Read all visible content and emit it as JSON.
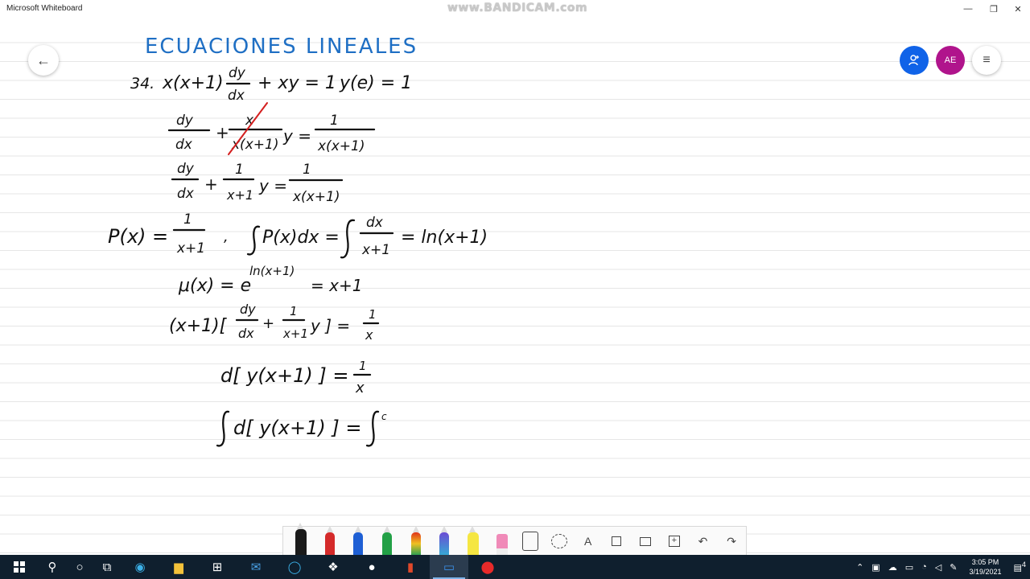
{
  "window": {
    "title": "Microsoft Whiteboard",
    "watermark": "www.BANDICAM.com"
  },
  "header": {
    "share_icon": "person-add-icon",
    "avatar_initials": "AE",
    "menu_icon": "hamburger-icon",
    "back_icon": "arrow-left-icon"
  },
  "board": {
    "title": "ECUACIONES LINEALES",
    "title_color": "#1f6fc4",
    "lines": [
      "34. x(x+1) dy/dx + xy = 1 ,  y(e) = 1",
      "dy/dx + x/(x(x+1)) y = 1/(x(x+1))",
      "dy/dx + 1/(x+1) y = 1/(x(x+1))",
      "P(x) = 1/(x+1) ,  ∫P(x)dx = ∫dx/(x+1) = ln(x+1)",
      "μ(x) = e^ln(x+1) = x+1",
      "(x+1)[ dy/dx + 1/(x+1) y ] = 1/x",
      "d[ y(x+1) ] = 1/x",
      "∫d[ y(x+1) ] = ∫"
    ],
    "strike_color": "#d41f1f"
  },
  "toolbar": {
    "tools": [
      {
        "name": "black-pen",
        "color": "#1a1a1a"
      },
      {
        "name": "red-pen",
        "color": "#d42a2a"
      },
      {
        "name": "blue-pen",
        "color": "#1e5fd4"
      },
      {
        "name": "green-pen",
        "color": "#22a046"
      },
      {
        "name": "rainbow-pen",
        "color": "#e07b1a"
      },
      {
        "name": "galaxy-pen",
        "color": "#4a6bd4"
      },
      {
        "name": "highlighter",
        "color": "#f5e642"
      },
      {
        "name": "eraser",
        "color": "#f08ab8"
      }
    ],
    "icons": [
      "ruler-icon",
      "lasso-icon",
      "text-icon",
      "sticky-note-icon",
      "image-icon",
      "add-icon",
      "undo-icon",
      "redo-icon"
    ],
    "text_glyph": "A"
  },
  "taskbar": {
    "time": "3:05 PM",
    "date": "3/19/2021",
    "notifications": "4"
  }
}
